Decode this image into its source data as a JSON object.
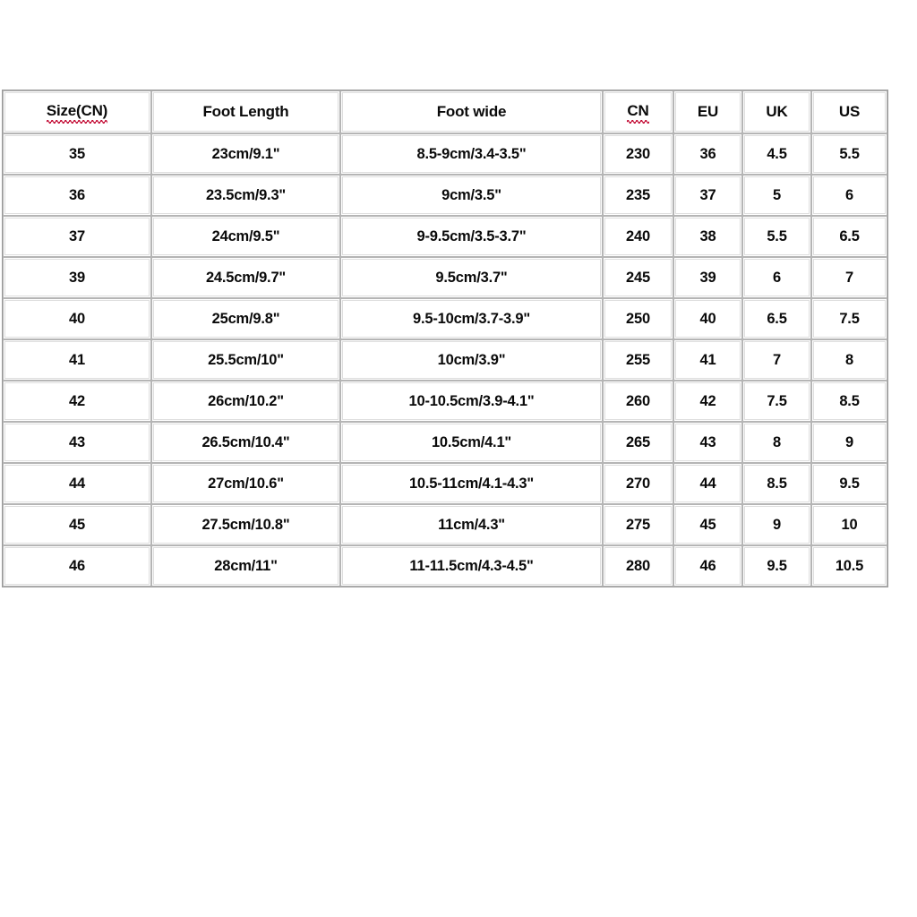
{
  "table": {
    "name": "shoe-size-conversion-chart",
    "headers": [
      {
        "label": "Size(CN)",
        "misspelled": true
      },
      {
        "label": "Foot Length",
        "misspelled": false
      },
      {
        "label": "Foot wide",
        "misspelled": false
      },
      {
        "label": "CN",
        "misspelled": true
      },
      {
        "label": "EU",
        "misspelled": false
      },
      {
        "label": "UK",
        "misspelled": false
      },
      {
        "label": "US",
        "misspelled": false
      }
    ],
    "rows": [
      {
        "size_cn": "35",
        "foot_length": "23cm/9.1\"",
        "foot_wide": "8.5-9cm/3.4-3.5\"",
        "cn": "230",
        "eu": "36",
        "uk": "4.5",
        "us": "5.5"
      },
      {
        "size_cn": "36",
        "foot_length": "23.5cm/9.3\"",
        "foot_wide": "9cm/3.5\"",
        "cn": "235",
        "eu": "37",
        "uk": "5",
        "us": "6"
      },
      {
        "size_cn": "37",
        "foot_length": "24cm/9.5\"",
        "foot_wide": "9-9.5cm/3.5-3.7\"",
        "cn": "240",
        "eu": "38",
        "uk": "5.5",
        "us": "6.5"
      },
      {
        "size_cn": "39",
        "foot_length": "24.5cm/9.7\"",
        "foot_wide": "9.5cm/3.7\"",
        "cn": "245",
        "eu": "39",
        "uk": "6",
        "us": "7"
      },
      {
        "size_cn": "40",
        "foot_length": "25cm/9.8\"",
        "foot_wide": "9.5-10cm/3.7-3.9\"",
        "cn": "250",
        "eu": "40",
        "uk": "6.5",
        "us": "7.5"
      },
      {
        "size_cn": "41",
        "foot_length": "25.5cm/10\"",
        "foot_wide": "10cm/3.9\"",
        "cn": "255",
        "eu": "41",
        "uk": "7",
        "us": "8"
      },
      {
        "size_cn": "42",
        "foot_length": "26cm/10.2\"",
        "foot_wide": "10-10.5cm/3.9-4.1\"",
        "cn": "260",
        "eu": "42",
        "uk": "7.5",
        "us": "8.5"
      },
      {
        "size_cn": "43",
        "foot_length": "26.5cm/10.4\"",
        "foot_wide": "10.5cm/4.1\"",
        "cn": "265",
        "eu": "43",
        "uk": "8",
        "us": "9"
      },
      {
        "size_cn": "44",
        "foot_length": "27cm/10.6\"",
        "foot_wide": "10.5-11cm/4.1-4.3\"",
        "cn": "270",
        "eu": "44",
        "uk": "8.5",
        "us": "9.5"
      },
      {
        "size_cn": "45",
        "foot_length": "27.5cm/10.8\"",
        "foot_wide": "11cm/4.3\"",
        "cn": "275",
        "eu": "45",
        "uk": "9",
        "us": "10"
      },
      {
        "size_cn": "46",
        "foot_length": "28cm/11\"",
        "foot_wide": "11-11.5cm/4.3-4.5\"",
        "cn": "280",
        "eu": "46",
        "uk": "9.5",
        "us": "10.5"
      }
    ]
  },
  "colors": {
    "page_background": "#ffffff",
    "cell_background": "#ffffff",
    "text": "#0a0a0a",
    "cell_border": "#b5b5b5",
    "cell_inner_border": "#dedede",
    "table_border": "#9a9a9a",
    "spellcheck_underline": "#c0002b"
  }
}
